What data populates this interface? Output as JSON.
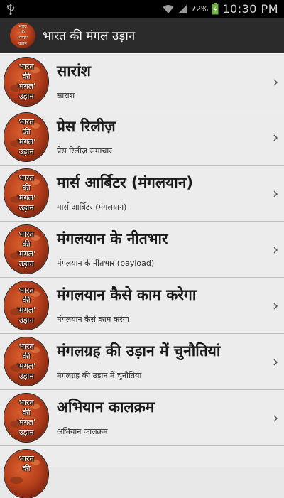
{
  "statusbar": {
    "battery_pct": "72%",
    "time": "10:30 PM"
  },
  "actionbar": {
    "title": "भारत की मंगल उड़ान",
    "icon_label": [
      "भारत",
      "की",
      "'मंगल'",
      "उड़ान"
    ]
  },
  "planet_label": [
    "भारत",
    "की",
    "'मंगल'",
    "उड़ान"
  ],
  "items": [
    {
      "title": "सारांश",
      "subtitle": "सारांश"
    },
    {
      "title": "प्रेस रिलीज़",
      "subtitle": "प्रेस रिलीज़ समाचार"
    },
    {
      "title": "मार्स आर्बिटर (मंगलयान)",
      "subtitle": "मार्स आर्बिटर (मंगलयान)"
    },
    {
      "title": "मंगलयान के नीतभार",
      "subtitle": "मंगलयान के नीतभार (payload)"
    },
    {
      "title": "मंगलयान कैसे काम करेगा",
      "subtitle": "मंगलयान कैसे काम करेगा"
    },
    {
      "title": "मंगलग्रह की उड़ान में चुनौतियां",
      "subtitle": "मंगलग्रह की उड़ान में चुनौतियां"
    },
    {
      "title": "अभियान कालक्रम",
      "subtitle": "अभियान कालक्रम"
    }
  ],
  "icons": {
    "usb": "usb-icon",
    "wifi": "wifi-icon",
    "signal": "signal-icon",
    "battery": "battery-charging-icon",
    "chevron": "chevron-right-icon"
  }
}
